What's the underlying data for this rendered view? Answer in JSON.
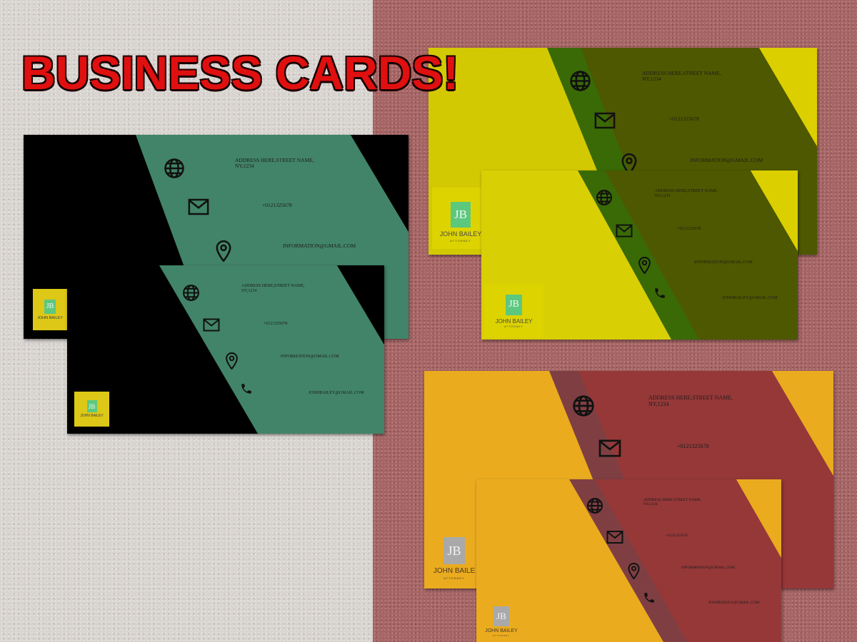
{
  "headline": "BUSINESS CARDS!",
  "card_text": {
    "address": "ADDRESS HERE,STREET NAME,",
    "address2": "NY,1234",
    "phone": "+0121325678",
    "email": "INFORMATION@GMAIL.COM",
    "email2": "JONHBAILEY@GMAIL.COM",
    "monogram": "JB",
    "name": "JOHN BAILEY",
    "name_cropped": "JOHN BAILE",
    "role": "ATTORNEY"
  },
  "icons": [
    "globe-icon",
    "envelope-icon",
    "location-pin-icon",
    "phone-icon"
  ],
  "colors": {
    "headline_fill": "#e01010",
    "headline_outline": "#1a0000",
    "black_card": "#000000",
    "teal_panel": "#428469",
    "teal_band": "#3c7c62",
    "yellow_card": "#d8cf05",
    "olive_panel": "#4d5800",
    "green_band": "#3a6a05",
    "orange_card": "#e8ad1f",
    "maroon_panel": "#963838",
    "maroon_band": "#7f3f42",
    "logo_yellow": "#ddc817",
    "logo_green": "#5cc87e",
    "logo_gray": "#a9a9a9"
  }
}
